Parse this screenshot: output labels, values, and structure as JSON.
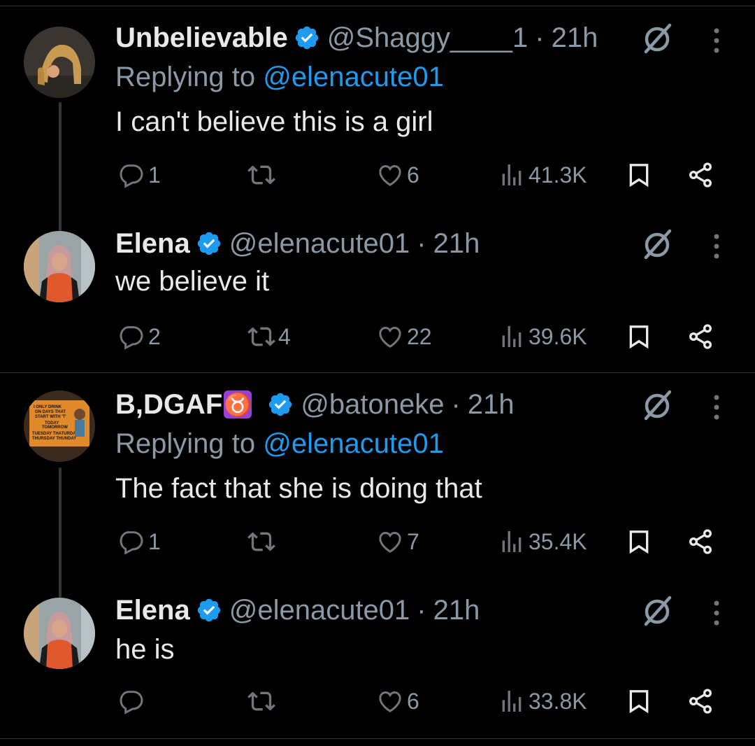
{
  "colors": {
    "background": "#000000",
    "text": "#e7e9ea",
    "muted": "#8b98a5",
    "accent": "#1d9bf0",
    "divider": "#2f3336"
  },
  "tweets": [
    {
      "name": "Unbelievable",
      "handle": "@Shaggy____1",
      "dot": "·",
      "time": "21h",
      "replying_prefix": "Replying to ",
      "replying_to": "@elenacute01",
      "text": "I can't believe this is a girl",
      "replies": "1",
      "retweets": "",
      "likes": "6",
      "views": "41.3K",
      "icons": [
        "reply-icon",
        "retweet-icon",
        "like-icon",
        "views-icon",
        "bookmark-icon",
        "share-icon",
        "grok-icon",
        "more-icon",
        "verified-icon"
      ]
    },
    {
      "name": "Elena",
      "handle": "@elenacute01",
      "dot": "·",
      "time": "21h",
      "text": "we believe it",
      "replies": "2",
      "retweets": "4",
      "likes": "22",
      "views": "39.6K"
    },
    {
      "name": "B,DGAF",
      "emoji": "♉",
      "handle": "@batoneke",
      "dot": "·",
      "time": "21h",
      "replying_prefix": "Replying to ",
      "replying_to": "@elenacute01",
      "text": "The fact that she is doing that",
      "replies": "1",
      "retweets": "",
      "likes": "7",
      "views": "35.4K",
      "avatar_text": [
        "I ONLY DRINK",
        "ON DAYS THAT",
        "START WITH 'T'",
        "TODAY",
        "TOMORROW",
        "TUESDAY  THATURDAY",
        "THURSDAY  THUNDAY"
      ]
    },
    {
      "name": "Elena",
      "handle": "@elenacute01",
      "dot": "·",
      "time": "21h",
      "text": "he is",
      "replies": "",
      "retweets": "",
      "likes": "6",
      "views": "33.8K"
    }
  ]
}
